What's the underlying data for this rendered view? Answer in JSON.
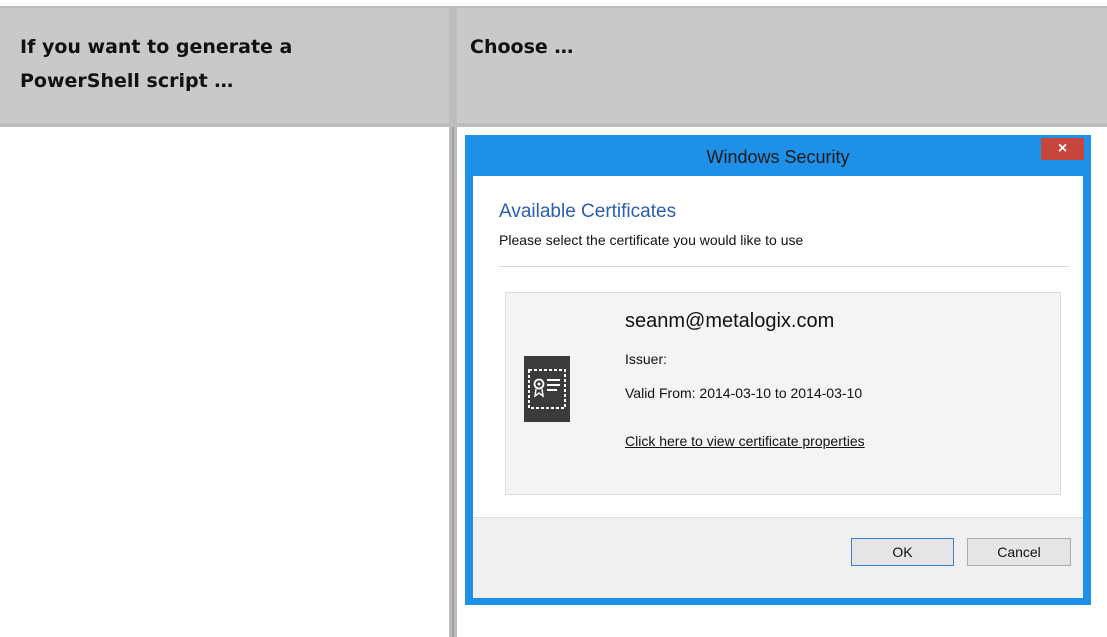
{
  "table": {
    "header_left": "If you want to generate a PowerShell script …",
    "header_right": "Choose …"
  },
  "dialog": {
    "title": "Windows Security",
    "close_glyph": "×",
    "heading": "Available Certificates",
    "subheading": "Please select the certificate you would like to use",
    "certificate": {
      "icon": "certificate-icon",
      "email": "seanm@metalogix.com",
      "issuer": "Issuer:",
      "valid": "Valid From: 2014-03-10 to 2014-03-10",
      "link": "Click here to view certificate properties"
    },
    "ok_label": "OK",
    "cancel_label": "Cancel"
  },
  "colors": {
    "header_bg": "#c9c9c9",
    "title_bar": "#1e90e8",
    "close_button": "#c7463b",
    "heading_text": "#2b5cad"
  }
}
